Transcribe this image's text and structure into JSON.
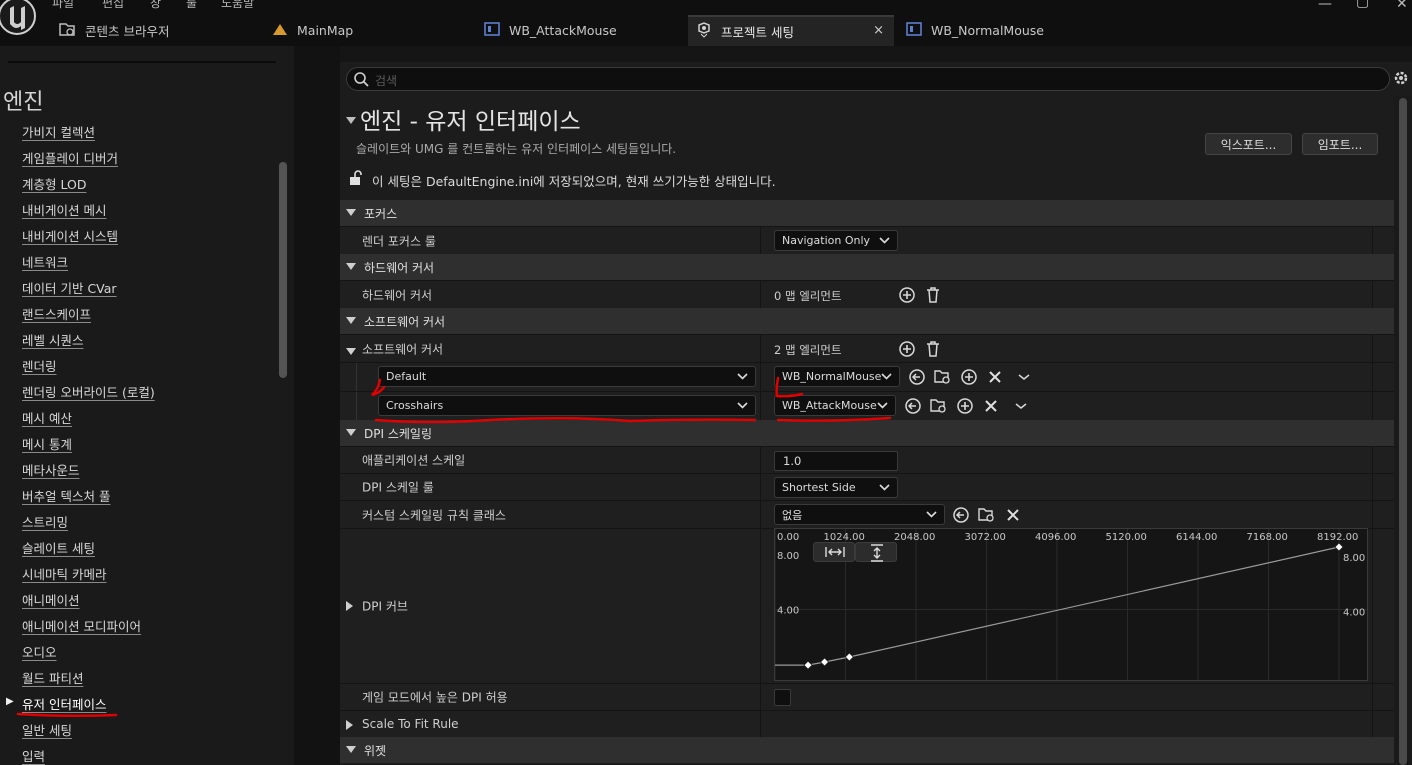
{
  "menubar": {
    "items": [
      "파일",
      "편집",
      "창",
      "툴",
      "도움말"
    ]
  },
  "tabs": [
    {
      "label": "콘텐츠 브라우저",
      "icon": "content-browser-icon"
    },
    {
      "label": "MainMap",
      "icon": "level-icon"
    },
    {
      "label": "WB_AttackMouse",
      "icon": "widget-blueprint-icon"
    },
    {
      "label": "프로젝트 세팅",
      "icon": "project-settings-icon",
      "active": true
    },
    {
      "label": "WB_NormalMouse",
      "icon": "widget-blueprint-icon"
    }
  ],
  "sidebar": {
    "heading": "엔진",
    "items": [
      "가비지 컬렉션",
      "게임플레이 디버거",
      "계층형 LOD",
      "내비게이션 메시",
      "내비게이션 시스템",
      "네트워크",
      "데이터 기반 CVar",
      "랜드스케이프",
      "레벨 시퀀스",
      "렌더링",
      "렌더링 오버라이드 (로컬)",
      "메시 예산",
      "메시 통계",
      "메타사운드",
      "버추얼 텍스처 풀",
      "스트리밍",
      "슬레이트 세팅",
      "시네마틱 카메라",
      "애니메이션",
      "애니메이션 모디파이어",
      "오디오",
      "월드 파티션",
      "유저 인터페이스",
      "일반 세팅",
      "입력"
    ],
    "selected": "유저 인터페이스"
  },
  "search": {
    "placeholder": "검색"
  },
  "page": {
    "title": "엔진 - 유저 인터페이스",
    "description": "슬레이트와 UMG 를 컨트롤하는 유저 인터페이스 세팅들입니다.",
    "export_label": "익스포트...",
    "import_label": "임포트...",
    "save_info": "이 세팅은 DefaultEngine.ini에 저장되었으며, 현재 쓰기가능한 상태입니다."
  },
  "sections": {
    "focus": {
      "title": "포커스",
      "render_focus_rule_label": "렌더 포커스 룰",
      "render_focus_rule_value": "Navigation Only"
    },
    "hardware_cursor": {
      "title": "하드웨어 커서",
      "label": "하드웨어 커서",
      "value": "0 맵 엘리먼트"
    },
    "software_cursor": {
      "title": "소프트웨어 커서",
      "label": "소프트웨어 커서",
      "value": "2 맵 엘리먼트",
      "entries": [
        {
          "key": "Default",
          "value": "WB_NormalMouse"
        },
        {
          "key": "Crosshairs",
          "value": "WB_AttackMouse"
        }
      ]
    },
    "dpi_scaling": {
      "title": "DPI 스케일링",
      "app_scale_label": "애플리케이션 스케일",
      "app_scale_value": "1.0",
      "dpi_rule_label": "DPI 스케일 룰",
      "dpi_rule_value": "Shortest Side",
      "custom_rule_label": "커스텀 스케일링 규칙 클래스",
      "custom_rule_value": "없음",
      "dpi_curve_label": "DPI 커브",
      "allow_high_dpi_label": "게임 모드에서 높은 DPI 허용",
      "allow_high_dpi_checked": false
    },
    "scale_to_fit": {
      "label": "Scale To Fit Rule"
    },
    "widget": {
      "title": "위젯"
    }
  },
  "chart_data": {
    "type": "line",
    "x_ticks": [
      "0.00",
      "1024.00",
      "2048.00",
      "3072.00",
      "4096.00",
      "5120.00",
      "6144.00",
      "7168.00",
      "8192.00"
    ],
    "y_ticks": [
      "8.00",
      "4.00"
    ],
    "xlim": [
      0,
      8192
    ],
    "ylim": [
      0,
      8
    ],
    "series": [
      {
        "points": [
          [
            480,
            0.44
          ],
          [
            720,
            0.64
          ],
          [
            1080,
            0.96
          ],
          [
            8192,
            8.0
          ]
        ]
      }
    ]
  },
  "colors": {
    "annotation": "#e00000",
    "background": "#1c1c1c",
    "section": "#2f2f2f"
  }
}
